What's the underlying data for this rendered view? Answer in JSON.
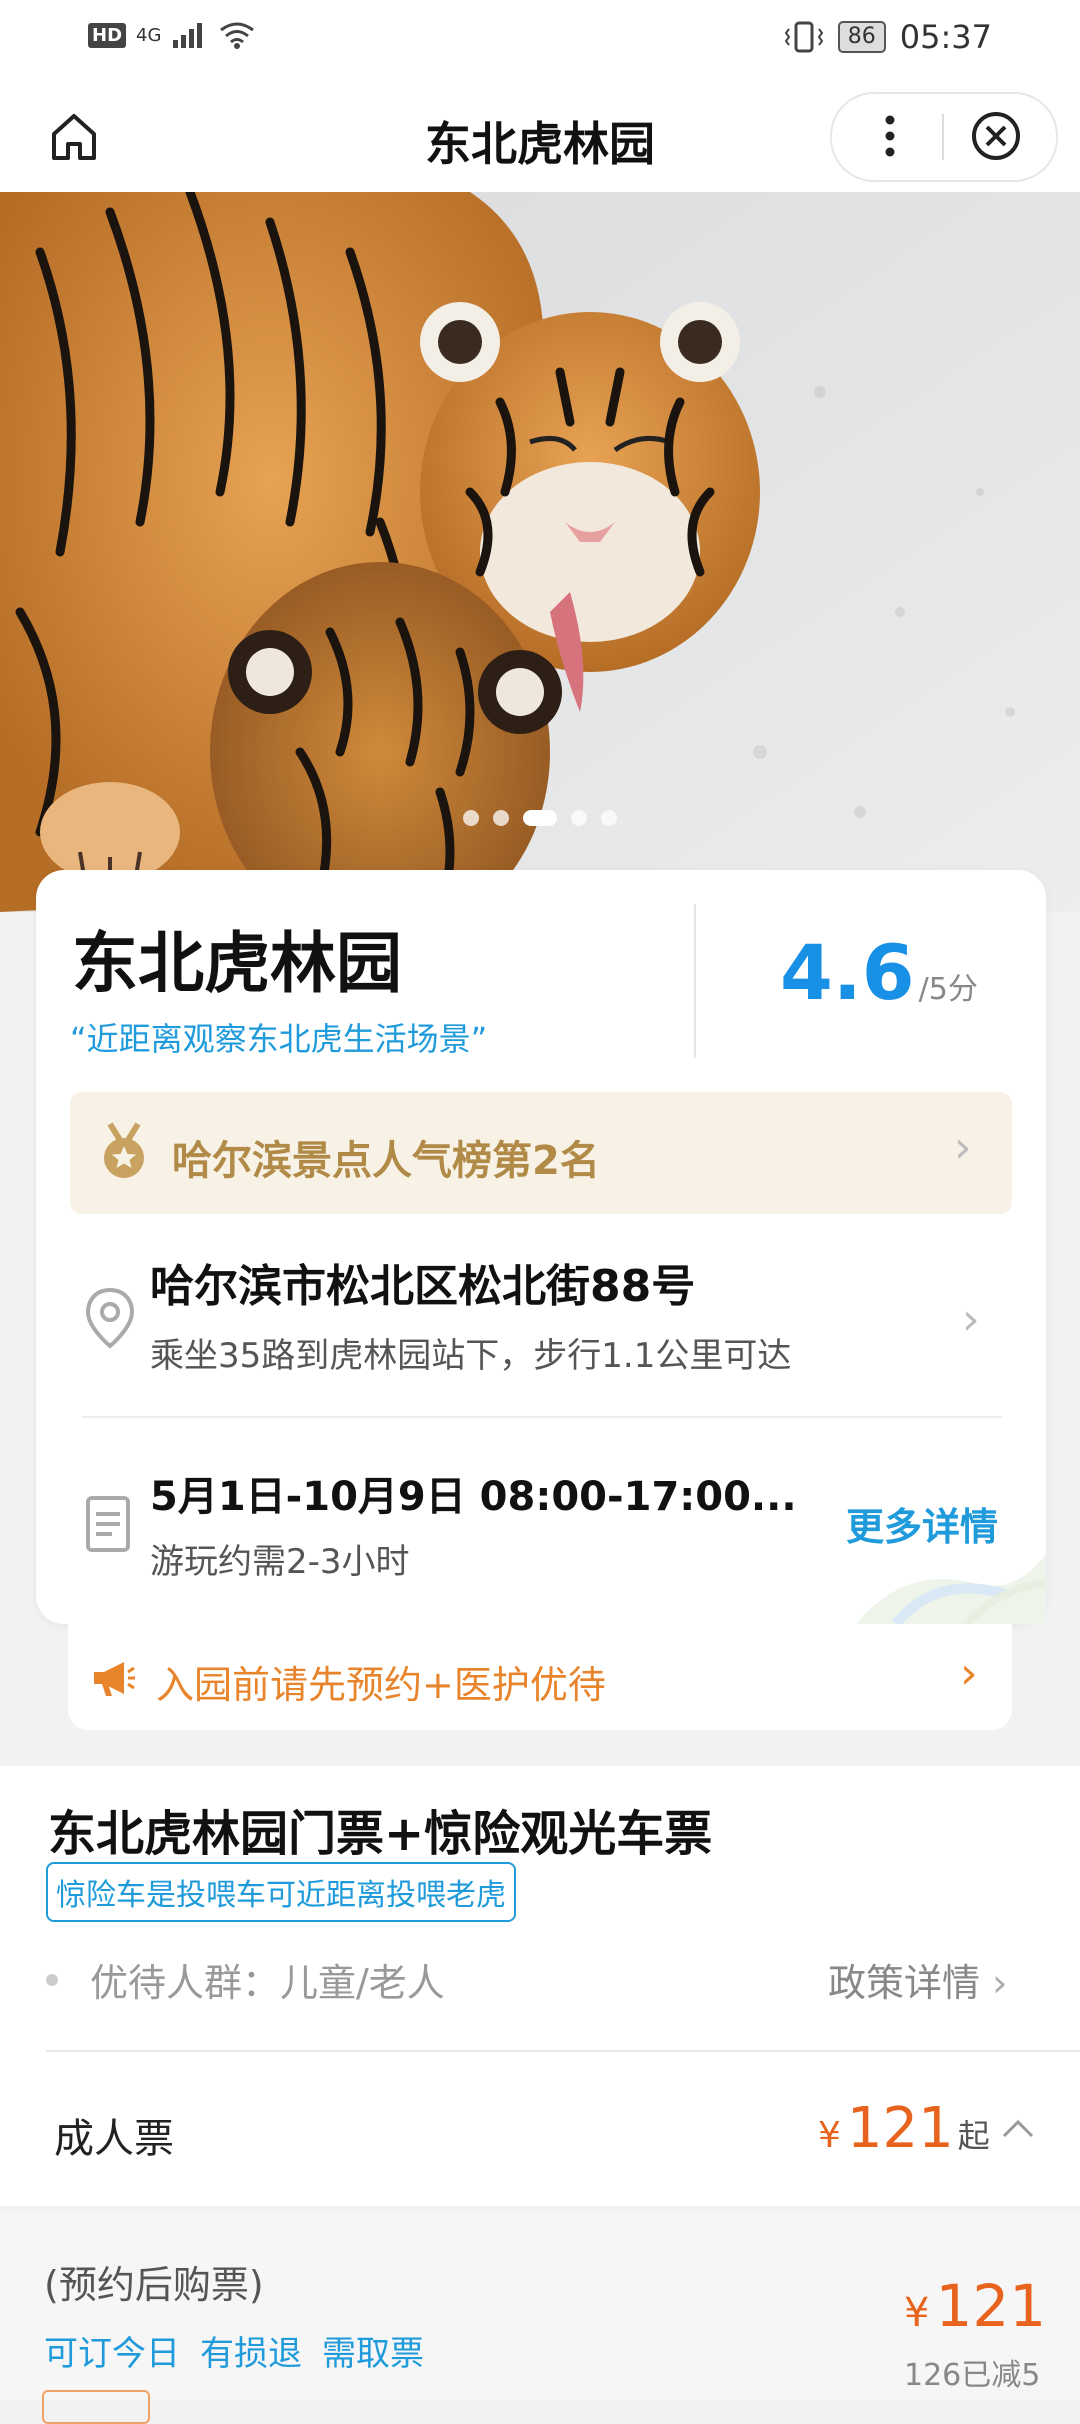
{
  "status_bar": {
    "network_badge": "HD",
    "signal_label": "4G",
    "battery": "86",
    "time": "05:37"
  },
  "nav": {
    "title": "东北虎林园"
  },
  "hero": {
    "slides_total": 5,
    "active_slide": 3
  },
  "card": {
    "title": "东北虎林园",
    "slogan": "“近距离观察东北虎生活场景”",
    "rating": {
      "value": "4.6",
      "max": "/5分"
    },
    "rank_text": "哈尔滨景点人气榜第2名",
    "address": {
      "main": "哈尔滨市松北区松北街88号",
      "sub": "乘坐35路到虎林园站下，步行1.1公里可达"
    },
    "hours": {
      "main": "5月1日-10月9日 08:00-17:00...",
      "sub": "游玩约需2-3小时"
    },
    "more_details": "更多详情"
  },
  "notice": {
    "text": "入园前请先预约+医护优待"
  },
  "product": {
    "title": "东北虎林园门票+惊险观光车票",
    "tag": "惊险车是投喂车可近距离投喂老虎",
    "special_groups": "优待人群：儿童/老人",
    "policy_label": "政策详情",
    "ticket_type": "成人票",
    "currency": "¥",
    "price": "121",
    "price_suffix": "起"
  },
  "sub_ticket": {
    "title": "(预约后购票)",
    "tags": [
      "可订今日",
      "有损退",
      "需取票"
    ],
    "currency": "¥",
    "price": "121",
    "discount": "126已减5"
  },
  "colors": {
    "accent_blue": "#1890e6",
    "price_orange": "#e8641e",
    "notice_orange": "#e8852c",
    "rank_gold": "#b08a46"
  }
}
